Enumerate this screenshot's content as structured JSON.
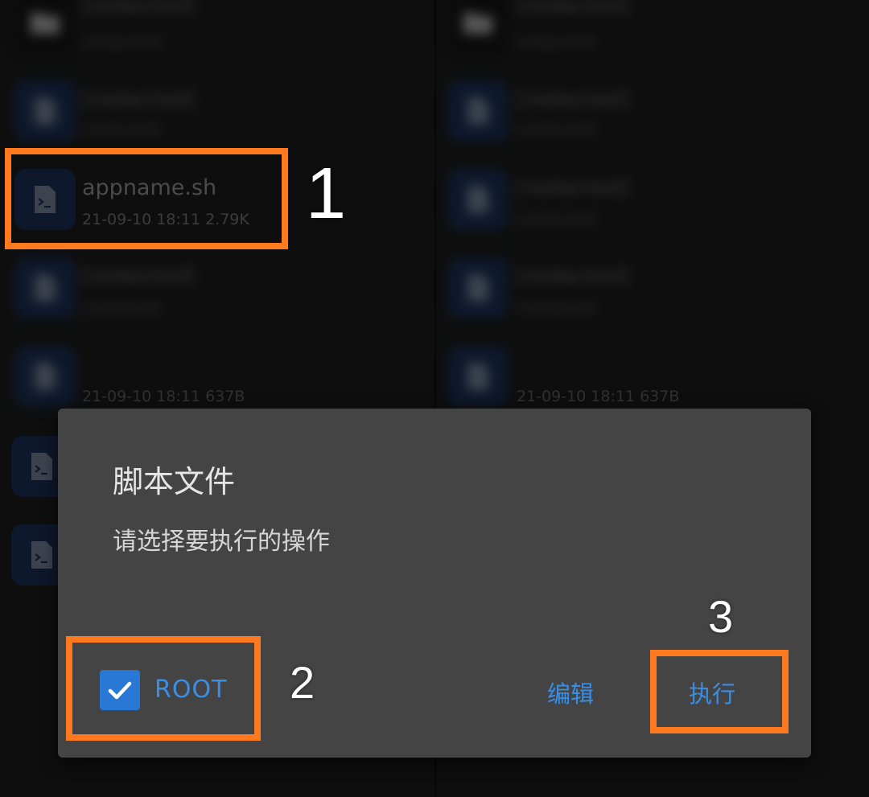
{
  "left_pane": {
    "folder_row": {
      "name": "[redacted]",
      "meta": "[redacted]"
    },
    "rows": [
      {
        "name": "[redacted]",
        "meta": "[redacted]"
      },
      {
        "name": "appname.sh",
        "meta": "21-09-10 18:11  2.79K"
      },
      {
        "name": "[redacted]",
        "meta": "[redacted]"
      },
      {
        "name": "[redacted]",
        "meta": "21-09-10 18:11  637B"
      }
    ]
  },
  "right_pane": {
    "folder_row": {
      "name": "[redacted]",
      "meta": "[redacted]"
    },
    "rows": [
      {
        "name": "[redacted]",
        "meta": "[redacted]"
      },
      {
        "name": "[redacted]",
        "meta": "[redacted]"
      },
      {
        "name": "[redacted]",
        "meta": "[redacted]"
      },
      {
        "name": "[redacted]",
        "meta": "21-09-10 18:11  637B"
      }
    ]
  },
  "dialog": {
    "title": "脚本文件",
    "message": "请选择要执行的操作",
    "checkbox_label": "ROOT",
    "checkbox_checked": true,
    "edit_button": "编辑",
    "execute_button": "执行"
  },
  "callouts": {
    "one": "1",
    "two": "2",
    "three": "3"
  },
  "colors": {
    "highlight": "#ff7a1e",
    "accent": "#3b8ee6",
    "file_icon": "#142e60"
  },
  "icons": {
    "file": "terminal-file-icon",
    "folder": "folder-icon",
    "check": "checkmark-icon"
  }
}
